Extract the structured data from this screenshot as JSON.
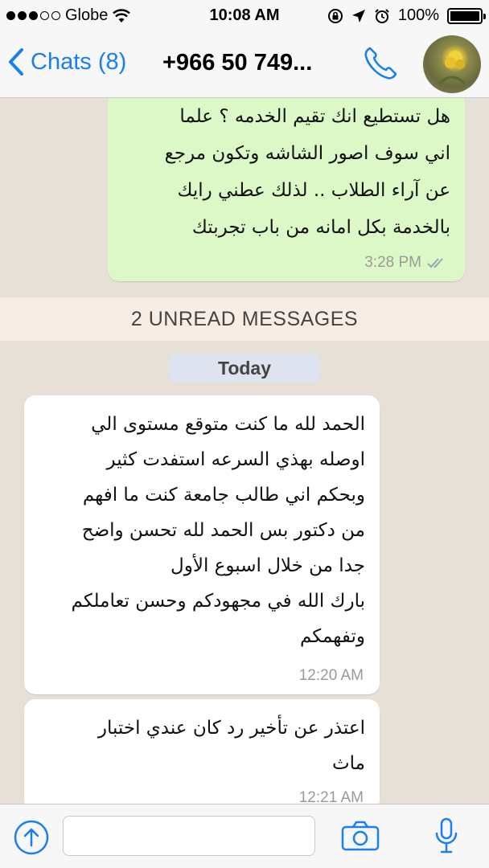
{
  "status_bar": {
    "carrier": "Globe",
    "time": "10:08 AM",
    "battery": "100%",
    "battery_level": 1.0
  },
  "nav": {
    "back_label": "Chats (8)",
    "contact_title": "+966 50 749...",
    "icons": [
      "chevron-left-icon",
      "phone-icon",
      "avatar"
    ]
  },
  "messages": [
    {
      "direction": "outgoing",
      "text": "هل تستطيع انك تقيم الخدمه ؟ علما\nاني سوف اصور الشاشه وتكون مرجع\nعن آراء الطلاب .. لذلك عطني رايك\nبالخدمة بكل امانه من باب تجربتك",
      "time": "3:28 PM",
      "status": "read"
    }
  ],
  "unread_banner": "2 UNREAD MESSAGES",
  "day_label": "Today",
  "incoming": [
    {
      "text": "الحمد لله ما كنت متوقع مستوى الي\nاوصله بهذي السرعه استفدت كثير\nوبحكم اني طالب جامعة كنت ما افهم\nمن دكتور بس الحمد لله تحسن واضح\nجدا من خلال اسبوع الأول\nبارك الله في مجهودكم وحسن تعاملكم\nوتفهمكم",
      "time": "12:20 AM"
    },
    {
      "text": "اعتذر عن تأخير رد كان عندي اختبار\nماث",
      "time": "12:21 AM"
    }
  ],
  "input_bar": {
    "icons": [
      "upload-icon",
      "camera-icon",
      "microphone-icon"
    ]
  },
  "colors": {
    "accent": "#1a7ff0",
    "outgoing_bubble": "#dcf8c6",
    "incoming_bubble": "#ffffff",
    "chat_background": "#e6e0d6",
    "read_ticks": "#8fa9b8"
  }
}
